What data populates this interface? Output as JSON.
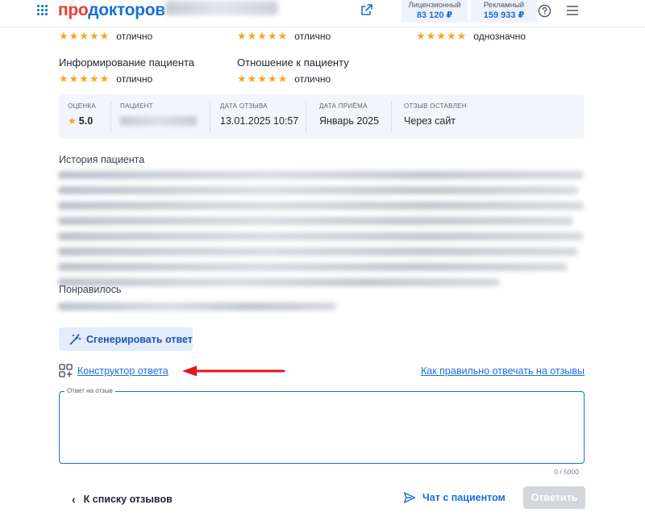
{
  "header": {
    "logo_pro": "про",
    "logo_doc": "докторов",
    "balances": [
      {
        "label": "Лицензионный",
        "value": "83 120 ₽"
      },
      {
        "label": "Рекламный",
        "value": "159 933 ₽"
      }
    ]
  },
  "ratings": [
    {
      "label": "",
      "stars": "★★★★★",
      "text": "отлично"
    },
    {
      "label": "",
      "stars": "★★★★★",
      "text": "отлично"
    },
    {
      "label": "",
      "stars": "★★★★★",
      "text": "однозначно"
    },
    {
      "label": "Информирование пациента",
      "stars": "★★★★★",
      "text": "отлично"
    },
    {
      "label": "Отношение к пациенту",
      "stars": "★★★★★",
      "text": "отлично"
    }
  ],
  "info": {
    "score_key": "Оценка",
    "score_value": "5.0",
    "patient_key": "Пациент",
    "review_date_key": "Дата отзыва",
    "review_date_value": "13.01.2025 10:57",
    "visit_date_key": "Дата приёма",
    "visit_date_value": "Январь 2025",
    "source_key": "Отзыв оставлен",
    "source_value": "Через сайт"
  },
  "story": {
    "label": "История пациента"
  },
  "liked": {
    "label": "Понравилось"
  },
  "actions": {
    "generate_label": "Сгенерировать ответ",
    "constructor_label": "Конструктор ответа",
    "how_to_label": "Как правильно отвечать на отзывы"
  },
  "answer": {
    "legend": "Ответ на отзыв",
    "counter": "0 / 5000"
  },
  "footer": {
    "back_label": "К списку отзывов",
    "chat_label": "Чат с пациентом",
    "reply_label": "Ответить"
  },
  "colors": {
    "accent": "#1a6fd6",
    "brand_red": "#ef3b2d",
    "star": "#f5a623",
    "arrow": "#e3161b"
  }
}
